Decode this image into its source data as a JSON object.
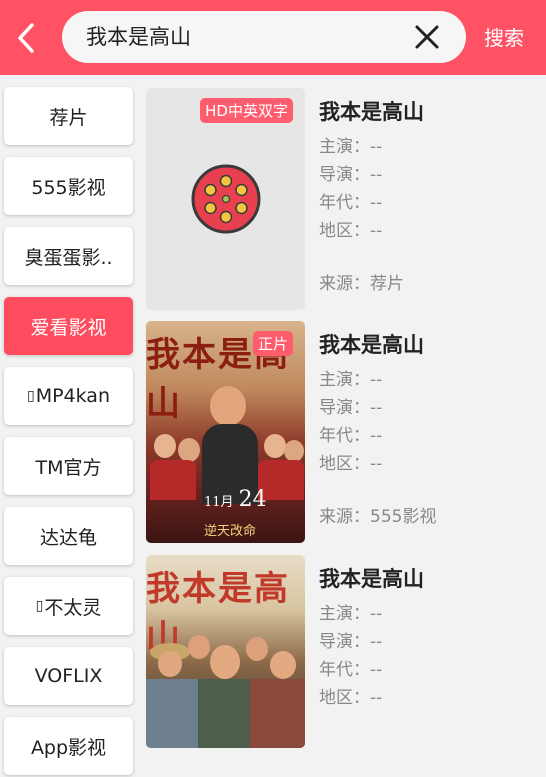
{
  "header": {
    "search_value": "我本是高山",
    "search_button": "搜索",
    "colors": {
      "bar": "#ff5365"
    }
  },
  "sidebar": {
    "items": [
      {
        "label": "荐片",
        "active": false
      },
      {
        "label": "555影视",
        "active": false
      },
      {
        "label": "臭蛋蛋影..",
        "active": false
      },
      {
        "label": "爱看影视",
        "active": true
      },
      {
        "label": "MP4kan",
        "active": false
      },
      {
        "label": "TM官方",
        "active": false
      },
      {
        "label": "达达龟",
        "active": false
      },
      {
        "label": "不太灵",
        "active": false
      },
      {
        "label": "VOFLIX",
        "active": false
      },
      {
        "label": "App影视",
        "active": false
      }
    ]
  },
  "results": [
    {
      "badge": "HD中英双字",
      "title": "我本是高山",
      "actors_label": "主演：--",
      "director_label": "导演：--",
      "year_label": "年代：--",
      "region_label": "地区：--",
      "source_label": "来源：荐片",
      "poster_icon": "film-reel-icon"
    },
    {
      "badge": "正片",
      "title": "我本是高山",
      "actors_label": "主演：--",
      "director_label": "导演：--",
      "year_label": "年代：--",
      "region_label": "地区：--",
      "source_label": "来源：555影视",
      "poster_calligraphy": "我本是高山",
      "poster_date_day": "24",
      "poster_date_month": "11月",
      "poster_tagline": "逆天改命"
    },
    {
      "title": "我本是高山",
      "actors_label": "主演：--",
      "director_label": "导演：--",
      "year_label": "年代：--",
      "region_label": "地区：--",
      "poster_calligraphy": "我本是高山"
    }
  ]
}
